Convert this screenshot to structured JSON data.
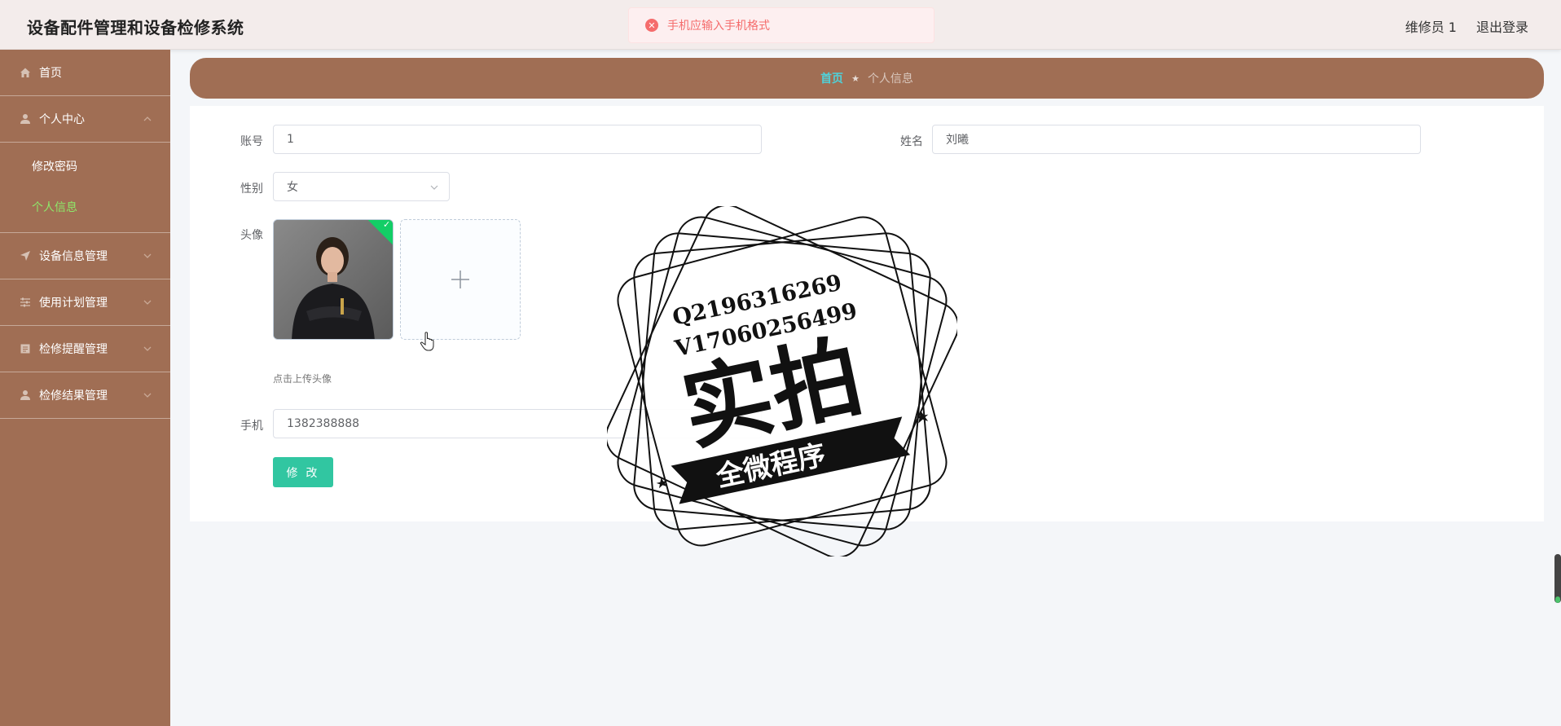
{
  "app": {
    "title": "设备配件管理和设备检修系统",
    "user": "维修员 1",
    "logout": "退出登录"
  },
  "toast": {
    "icon": "error-icon",
    "message": "手机应输入手机格式",
    "color": "#f56c6c"
  },
  "sidebar": {
    "items": [
      {
        "label": "首页",
        "icon": "home-icon"
      },
      {
        "label": "个人中心",
        "icon": "user-icon",
        "expanded": true,
        "children": [
          {
            "label": "修改密码"
          },
          {
            "label": "个人信息",
            "active": true
          }
        ]
      },
      {
        "label": "设备信息管理",
        "icon": "send-icon"
      },
      {
        "label": "使用计划管理",
        "icon": "sliders-icon"
      },
      {
        "label": "检修提醒管理",
        "icon": "document-icon"
      },
      {
        "label": "检修结果管理",
        "icon": "user-icon"
      }
    ]
  },
  "breadcrumb": {
    "home": "首页",
    "current": "个人信息"
  },
  "form": {
    "account_label": "账号",
    "account_value": "1",
    "name_label": "姓名",
    "name_value": "刘曦",
    "gender_label": "性别",
    "gender_value": "女",
    "avatar_label": "头像",
    "upload_hint": "点击上传头像",
    "phone_label": "手机",
    "phone_value": "1382388888",
    "submit_label": "修 改"
  },
  "watermark": {
    "line1": "Q2196316269",
    "line2": "V17060256499",
    "main": "实拍",
    "banner": "全微程序"
  },
  "colors": {
    "sidebar": "#a06e54",
    "accent_button": "#31c6a1",
    "active_menu": "#8ee86a",
    "breadcrumb_home": "#4fd1d9"
  }
}
